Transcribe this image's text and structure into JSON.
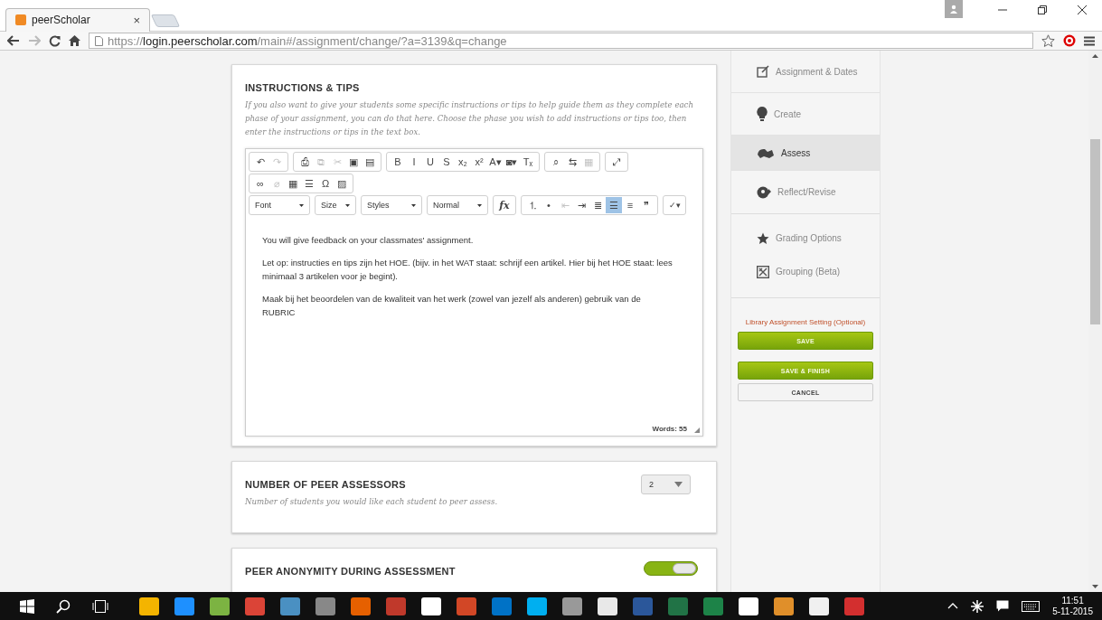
{
  "browser": {
    "tab": {
      "title": "peerScholar",
      "close": "×"
    },
    "url": {
      "scheme": "https://",
      "host": "login.peerscholar.com",
      "path": "/main#/assignment/change/?a=3139&q=change"
    }
  },
  "instructions": {
    "heading": "INSTRUCTIONS & TIPS",
    "description": "If you also want to give your students some specific instructions or tips to help guide them as they complete each phase of your assignment, you can do that here. Choose the phase you wish to add instructions or tips too, then enter the instructions or tips in the text box.",
    "toolbar_rows": [
      [
        [
          {
            "glyph": "↶",
            "disabled": false,
            "selected": false
          },
          {
            "glyph": "↷",
            "disabled": true,
            "selected": false
          }
        ],
        [
          {
            "glyph": "⎙",
            "disabled": false,
            "selected": false
          },
          {
            "glyph": "⧉",
            "disabled": true,
            "selected": false
          },
          {
            "glyph": "✂",
            "disabled": true,
            "selected": false
          },
          {
            "glyph": "▣",
            "disabled": false,
            "selected": false
          },
          {
            "glyph": "▤",
            "disabled": false,
            "selected": false
          }
        ],
        [
          {
            "glyph": "B",
            "disabled": false,
            "selected": false
          },
          {
            "glyph": "I",
            "disabled": false,
            "selected": false
          },
          {
            "glyph": "U",
            "disabled": false,
            "selected": false
          },
          {
            "glyph": "S",
            "disabled": false,
            "selected": false
          },
          {
            "glyph": "x₂",
            "disabled": false,
            "selected": false
          },
          {
            "glyph": "x²",
            "disabled": false,
            "selected": false
          },
          {
            "glyph": "A▾",
            "disabled": false,
            "selected": false
          },
          {
            "glyph": "◙▾",
            "disabled": false,
            "selected": false
          },
          {
            "glyph": "Tₓ",
            "disabled": false,
            "selected": false
          }
        ],
        [
          {
            "glyph": "⌕",
            "disabled": false,
            "selected": false
          },
          {
            "glyph": "⇆",
            "disabled": false,
            "selected": false
          },
          {
            "glyph": "▦",
            "disabled": true,
            "selected": false
          }
        ],
        [
          {
            "glyph": "⤢",
            "disabled": false,
            "selected": false
          }
        ]
      ],
      [
        [
          {
            "glyph": "∞",
            "disabled": false,
            "selected": false
          },
          {
            "glyph": "⌀",
            "disabled": true,
            "selected": false
          },
          {
            "glyph": "▦",
            "disabled": false,
            "selected": false
          },
          {
            "glyph": "☰",
            "disabled": false,
            "selected": false
          },
          {
            "glyph": "Ω",
            "disabled": false,
            "selected": false
          },
          {
            "glyph": "▨",
            "disabled": false,
            "selected": false
          }
        ]
      ]
    ],
    "dropdowns": [
      "Font",
      "Size",
      "Styles",
      "Normal"
    ],
    "formula": "fx",
    "format_buttons": [
      {
        "glyph": "⒈",
        "disabled": false,
        "selected": false
      },
      {
        "glyph": "•",
        "disabled": false,
        "selected": false
      },
      {
        "glyph": "⇤",
        "disabled": true,
        "selected": false
      },
      {
        "glyph": "⇥",
        "disabled": false,
        "selected": false
      },
      {
        "glyph": "≣",
        "disabled": false,
        "selected": false
      },
      {
        "glyph": "☰",
        "disabled": false,
        "selected": true
      },
      {
        "glyph": "≡",
        "disabled": false,
        "selected": false
      },
      {
        "glyph": "❞",
        "disabled": false,
        "selected": false
      }
    ],
    "spellcheck": "✓▾",
    "paragraphs": [
      "You will give feedback on your classmates' assignment.",
      "Let op: instructies en tips zijn het HOE. (bijv. in het WAT staat: schrijf een artikel. Hier bij het HOE staat: lees minimaal 3 artikelen voor je begint).",
      "Maak bij het beoordelen van de kwaliteit van het werk (zowel van jezelf als anderen) gebruik van de RUBRIC"
    ],
    "word_count": "Words: 55"
  },
  "peer_assessors": {
    "heading": "NUMBER OF PEER ASSESSORS",
    "description": "Number of students you would like each student to peer assess.",
    "value": "2"
  },
  "anonymity": {
    "heading": "PEER ANONYMITY DURING ASSESSMENT",
    "on": true
  },
  "sidebar": {
    "groups": [
      [
        {
          "label": "Assignment & Dates",
          "selected": false
        },
        {
          "label": "Create",
          "selected": false
        },
        {
          "label": "Assess",
          "selected": true
        },
        {
          "label": "Reflect/Revise",
          "selected": false
        }
      ],
      [
        {
          "label": "Grading Options",
          "selected": false
        },
        {
          "label": "Grouping (Beta)",
          "selected": false
        }
      ]
    ],
    "library_link": "Library Assignment Setting (Optional)",
    "save": "SAVE",
    "save_finish": "SAVE & FINISH",
    "cancel": "CANCEL"
  },
  "taskbar": {
    "time": "11:51",
    "date": "5-11-2015"
  }
}
